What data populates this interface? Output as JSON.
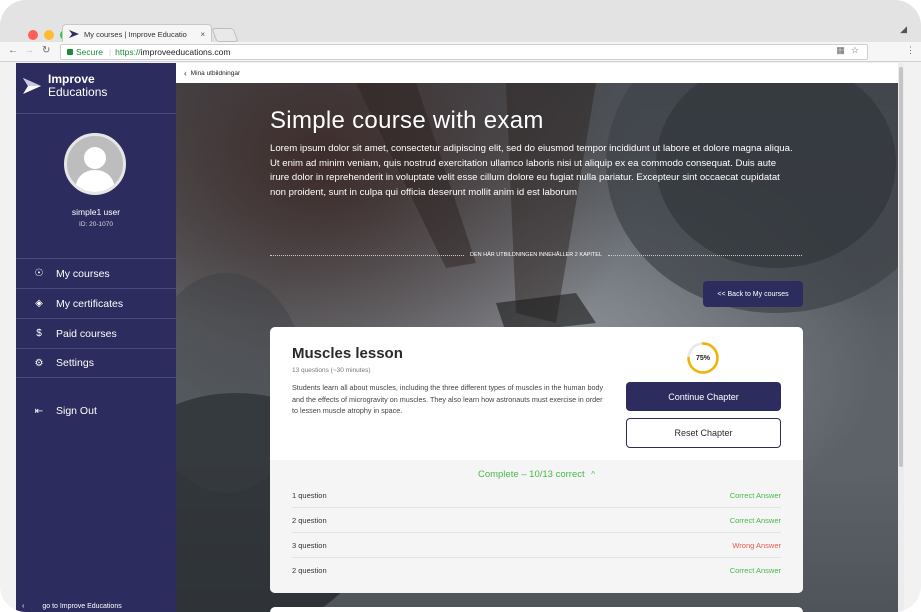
{
  "browser": {
    "tab_title": "My courses | Improve Educatio",
    "tab_close": "×",
    "secure_label": "Secure",
    "url_scheme": "https://",
    "url_host": "improveeducations.com",
    "colors": {
      "traffic_red": "#ff5f57",
      "traffic_yellow": "#febc2e",
      "traffic_green": "#28c840",
      "secure_green": "#1a8a3b"
    }
  },
  "sidebar": {
    "brand_line1": "Improve",
    "brand_line2": "Educations",
    "user_name": "simple1 user",
    "user_id": "ID: 20-1070",
    "items": [
      {
        "label": "My courses",
        "icon": "graduate-icon"
      },
      {
        "label": "My certificates",
        "icon": "mortarboard-icon"
      },
      {
        "label": "Paid courses",
        "icon": "dollar-icon"
      },
      {
        "label": "Settings",
        "icon": "gear-icon"
      }
    ],
    "sign_out": "Sign Out",
    "go_to": "go to Improve Educations",
    "colors": {
      "bg": "#2d2c5e"
    }
  },
  "main": {
    "breadcrumb": "Mina utbildningar",
    "course_title": "Simple course with exam",
    "course_description": "Lorem ipsum dolor sit amet, consectetur adipiscing elit, sed do eiusmod tempor incididunt ut labore et dolore magna aliqua. Ut enim ad minim veniam, quis nostrud exercitation ullamco laboris nisi ut aliquip ex ea commodo consequat. Duis aute irure dolor in reprehenderit in voluptate velit esse cillum dolore eu fugiat nulla pariatur. Excepteur sint occaecat cupidatat non proident, sunt in culpa qui officia deserunt mollit anim id est laborum",
    "chapter_count_text": "DEN HÄR UTBILDNINGEN INNEHÅLLER 2 KAPITEL",
    "back_button": "<< Back to My courses"
  },
  "lesson": {
    "title": "Muscles lesson",
    "subtitle": "13 questions (~30 minutes)",
    "description": "Students learn all about muscles, including the three different types of muscles in the human body and the effects of microgravity on muscles. They also learn how astronauts must exercise in order to lessen muscle atrophy in space.",
    "progress_value": 0.75,
    "progress_label": "75%",
    "continue_button": "Continue Chapter",
    "reset_button": "Reset Chapter",
    "results_summary": "Complete – 10/13 correct",
    "results_caret": "^",
    "questions": [
      {
        "label": "1 question",
        "status": "Correct Answer",
        "color": "#47b84a"
      },
      {
        "label": "2 question",
        "status": "Correct Answer",
        "color": "#47b84a"
      },
      {
        "label": "3 question",
        "status": "Wrong Answer",
        "color": "#e55a4e"
      },
      {
        "label": "2 question",
        "status": "Correct Answer",
        "color": "#47b84a"
      }
    ],
    "colors": {
      "progress_ring": "#f0b400",
      "accent": "#2d2c5e"
    }
  }
}
